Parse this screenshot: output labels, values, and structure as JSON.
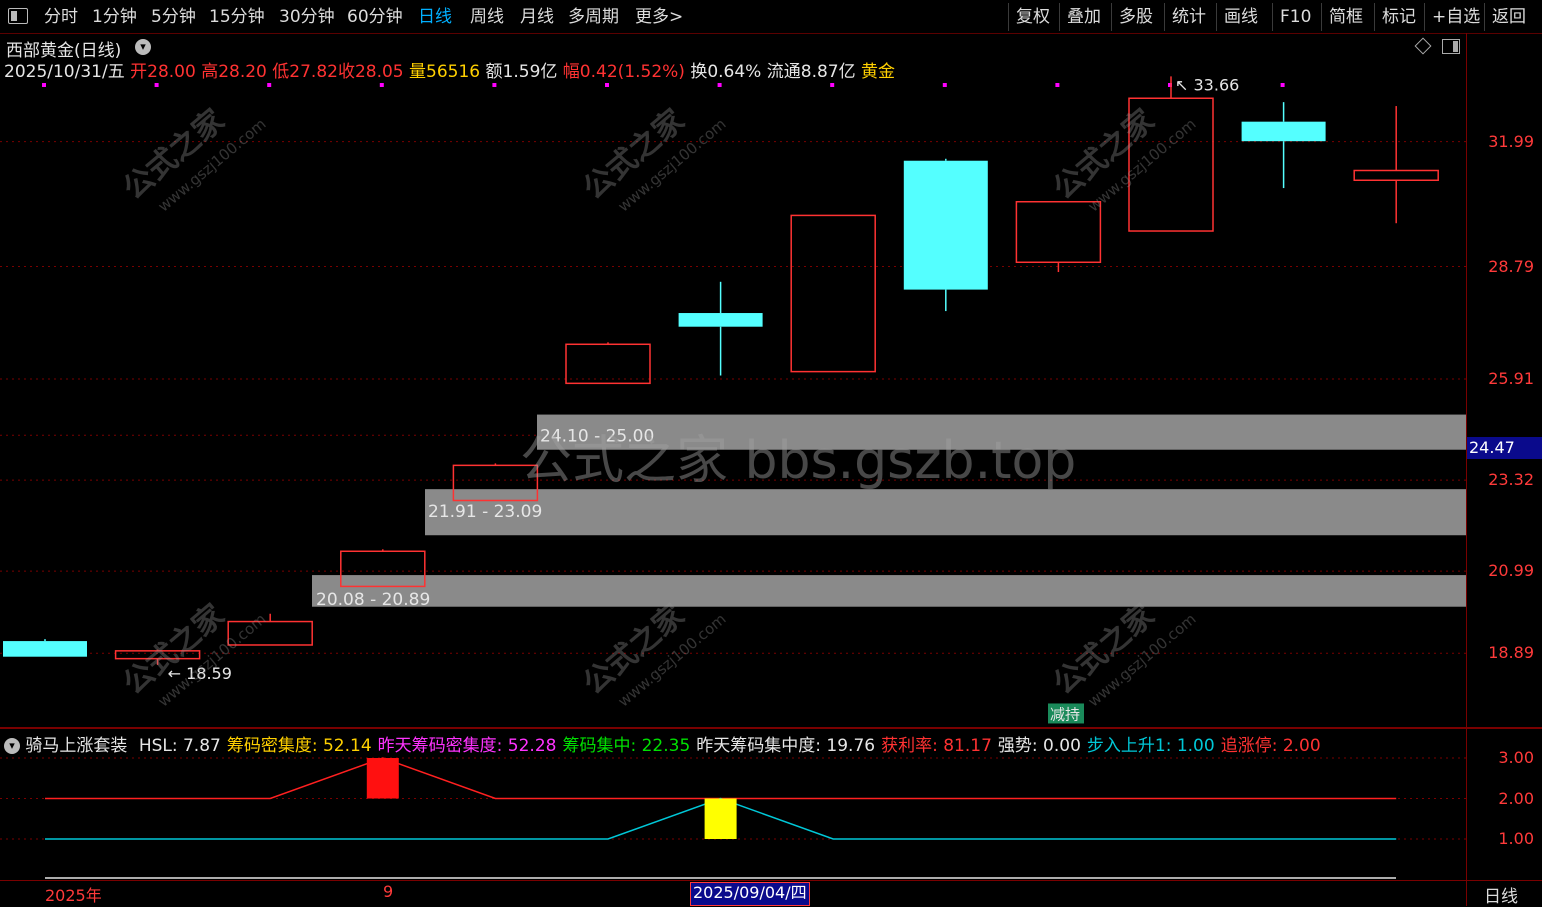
{
  "toolbar": {
    "menu_icon": "window-icon",
    "periods": [
      "分时",
      "1分钟",
      "5分钟",
      "15分钟",
      "30分钟",
      "60分钟",
      "日线",
      "周线",
      "月线",
      "多周期",
      "更多>"
    ],
    "active_period": "日线",
    "right_buttons": [
      "复权",
      "叠加",
      "多股",
      "统计",
      "画线",
      "F10",
      "简框",
      "标记",
      "+自选",
      "返回"
    ]
  },
  "header": {
    "title": "西部黄金(日线)",
    "date": "2025/10/31/五",
    "open_label": "开",
    "open": "28.00",
    "high_label": "高",
    "high": "28.20",
    "low_label": "低",
    "low": "27.82",
    "close_label": "收",
    "close": "28.05",
    "volume_label": "量",
    "volume": "56516",
    "amount_label": "额",
    "amount": "1.59亿",
    "change_label": "幅",
    "change": "0.42(1.52%)",
    "turnover_label": "换",
    "turnover": "0.64%",
    "float_label": "流通",
    "float_cap": "8.87亿",
    "sector": "黄金"
  },
  "price_axis": [
    "31.99",
    "28.79",
    "25.91",
    "24.47",
    "23.32",
    "20.99",
    "18.89"
  ],
  "current_price_tag": "24.47",
  "chart_data": {
    "type": "candlestick",
    "candles": [
      {
        "open": 19.2,
        "close": 18.8,
        "high": 19.25,
        "low": 18.8
      },
      {
        "open": 18.75,
        "close": 18.95,
        "high": 18.98,
        "low": 18.59
      },
      {
        "open": 19.1,
        "close": 19.7,
        "high": 19.9,
        "low": 19.1
      },
      {
        "open": 20.6,
        "close": 21.5,
        "high": 21.55,
        "low": 20.6
      },
      {
        "open": 22.8,
        "close": 23.7,
        "high": 23.75,
        "low": 22.8
      },
      {
        "open": 25.8,
        "close": 26.8,
        "high": 26.85,
        "low": 25.8
      },
      {
        "open": 27.6,
        "close": 27.25,
        "high": 28.4,
        "low": 26.0
      },
      {
        "open": 26.1,
        "close": 30.1,
        "high": 30.1,
        "low": 26.1
      },
      {
        "open": 31.5,
        "close": 28.2,
        "high": 31.55,
        "low": 27.65
      },
      {
        "open": 28.9,
        "close": 30.45,
        "high": 30.45,
        "low": 28.65
      },
      {
        "open": 29.7,
        "close": 33.1,
        "high": 33.66,
        "low": 29.7
      },
      {
        "open": 32.5,
        "close": 32.0,
        "high": 33.0,
        "low": 30.8
      },
      {
        "open": 31.0,
        "close": 31.25,
        "high": 32.9,
        "low": 29.9
      }
    ],
    "zones": [
      {
        "label": "24.10 - 25.00",
        "low": 24.1,
        "high": 25.0
      },
      {
        "label": "21.91 - 23.09",
        "low": 21.91,
        "high": 23.09
      },
      {
        "label": "20.08 - 20.89",
        "low": 20.08,
        "high": 20.89
      }
    ],
    "high_marker": "33.66",
    "low_marker": "18.59",
    "signal": "减持"
  },
  "indicator": {
    "name": "骑马上涨套装",
    "items": [
      {
        "label": "HSL: 7.87",
        "color": "#e6e6e6"
      },
      {
        "label": "筹码密集度: 52.14",
        "color": "#ffd000"
      },
      {
        "label": "昨天筹码密集度: 52.28",
        "color": "#ff33ff"
      },
      {
        "label": "筹码集中: 22.35",
        "color": "#00e000"
      },
      {
        "label": "昨天筹码集中度: 19.76",
        "color": "#e6e6e6"
      },
      {
        "label": "获利率: 81.17",
        "color": "#ff3232"
      },
      {
        "label": "强势: 0.00",
        "color": "#e6e6e6"
      },
      {
        "label": "步入上升1: 1.00",
        "color": "#00c8d8"
      },
      {
        "label": "追涨停: 2.00",
        "color": "#ff3232"
      }
    ],
    "axis": [
      "3.00",
      "2.00",
      "1.00"
    ],
    "line_red": [
      2,
      2,
      2,
      3,
      2,
      2,
      2,
      2,
      2,
      2,
      2,
      2,
      2
    ],
    "line_cyan": [
      1,
      1,
      1,
      1,
      1,
      1,
      2,
      1,
      1,
      1,
      1,
      1,
      1
    ]
  },
  "date_axis": {
    "year": "2025年",
    "month": "9",
    "cursor_date": "2025/09/04/四",
    "period": "日线"
  },
  "watermark": {
    "center": "公式之家 bbs.gszb.top",
    "stamp_cn": "公式之家",
    "stamp_url": "www.gszj100.com"
  }
}
